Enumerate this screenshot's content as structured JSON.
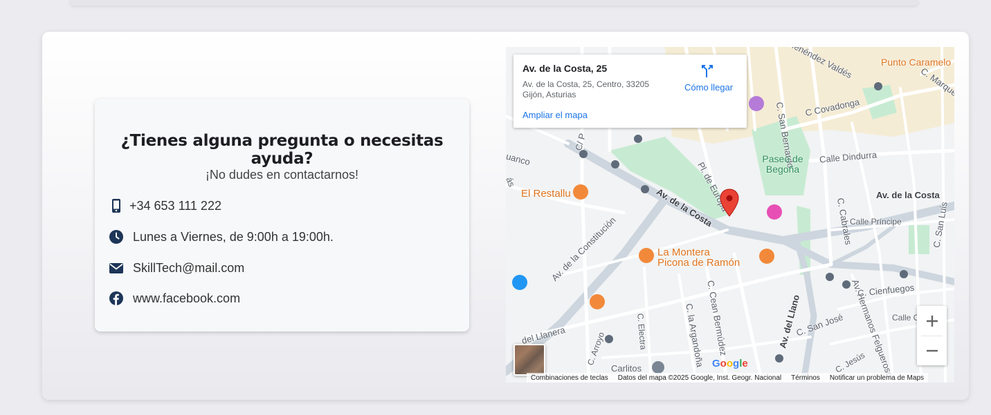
{
  "contact": {
    "title": "¿Tienes alguna pregunta o necesitas ayuda?",
    "subtitle": "¡No dudes en contactarnos!",
    "items": [
      {
        "icon": "phone-icon",
        "text": "+34 653 111 222"
      },
      {
        "icon": "clock-icon",
        "text": "Lunes a Viernes, de 9:00h a 19:00h."
      },
      {
        "icon": "envelope-icon",
        "text": "SkillTech@mail.com"
      },
      {
        "icon": "facebook-icon",
        "text": "www.facebook.com"
      }
    ]
  },
  "map": {
    "place_name": "Av. de la Costa, 25",
    "address_line1": "Av. de la Costa, 25, Centro, 33205",
    "address_line2": "Gijón, Asturias",
    "directions_label": "Cómo llegar",
    "enlarge_link": "Ampliar el mapa",
    "zoom_in": "+",
    "zoom_out": "−",
    "logo": "Google",
    "attribution": {
      "shortcuts": "Combinaciones de teclas",
      "data": "Datos del mapa ©2025 Google, Inst. Geogr. Nacional",
      "terms": "Términos",
      "report": "Notificar un problema de Maps"
    },
    "streets": {
      "menendez": "Menéndez Valdés",
      "punto": "Punto Caramelo",
      "marques": "C. Marqués",
      "san_bernardo": "C. San Bernardo",
      "covadonga": "C Covadonga",
      "paseo": "Paseo de Begoña",
      "dindurra": "Calle Dindurra",
      "pl_europa": "Pl. de Europa",
      "av_costa": "Av. de la Costa",
      "av_costa_right": "Av. de la Costa",
      "cabrales": "C. Cabrales",
      "principe": "Calle Príncipe",
      "san_luis": "C. San Luis",
      "constitucion": "Av. de la Constitución",
      "cean": "C. Cean Bermúdez",
      "arganonda": "C. la Argandoña",
      "electra": "C. Electra",
      "arroyo": "C. Arroyo",
      "llanera": "del Llanera",
      "llano": "Av. del Llano",
      "san_jose": "C. San José",
      "hermanos": "Av. Hermanos Felgueroso",
      "cienfuegos": "C. Cienfuegos",
      "calle_co": "Calle Co",
      "jesus": "C. Jesús",
      "carlitos": "Carlitos",
      "cuanco": "uanco",
      "c_p": "C/ P",
      "as": "ás"
    },
    "pois": {
      "restallu": "El Restallu",
      "montera1": "La Montera",
      "montera2": "Picona de Ramón"
    },
    "colors": {
      "park": "#c7ebd2",
      "marker": "#ea4335",
      "poi_orange": "#f2893a",
      "link": "#1a73e8"
    }
  }
}
